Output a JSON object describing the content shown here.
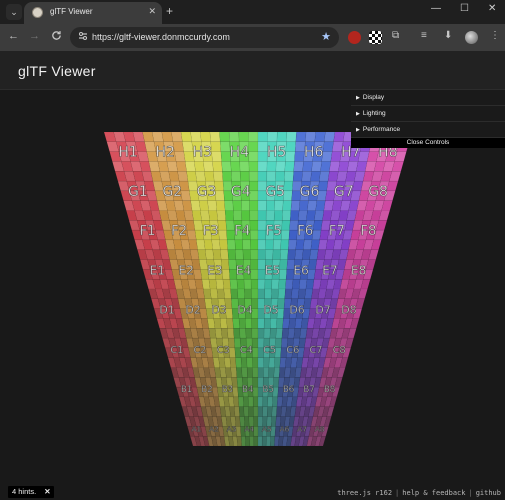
{
  "browser": {
    "tab_title": "glTF Viewer",
    "url": "https://gltf-viewer.donmccurdy.com",
    "icons": {
      "tab_list": "chevron-down-icon",
      "tab_close": "close-icon",
      "new_tab": "plus-icon",
      "minimize": "minimize-icon",
      "maximize": "maximize-icon",
      "close": "window-close-icon"
    }
  },
  "toolbar": {
    "back_glyph": "←",
    "forward_glyph": "→",
    "reload_glyph": "C",
    "tab_glyph": "✕",
    "newtab_glyph": "+",
    "min_glyph": "—",
    "max_glyph": "☐",
    "close_glyph": "✕",
    "star_glyph": "★",
    "tune_glyph": "⚙",
    "menu_glyph": "⋮",
    "ext_puzzle_glyph": "⧉",
    "media_glyph": "≡",
    "download_glyph": "⬇"
  },
  "app": {
    "title": "glTF Viewer"
  },
  "controls": {
    "folders": [
      "Display",
      "Lighting",
      "Performance"
    ],
    "close_label": "Close Controls"
  },
  "grid": {
    "rows": [
      "H",
      "G",
      "F",
      "E",
      "D",
      "C",
      "B",
      "A"
    ],
    "columns": [
      "1",
      "2",
      "3",
      "4",
      "5",
      "6",
      "7",
      "8"
    ]
  },
  "footer": {
    "hints_label": "4 hints.",
    "hints_close": "✕",
    "links": [
      "three.js r162",
      "help & feedback",
      "github"
    ]
  }
}
